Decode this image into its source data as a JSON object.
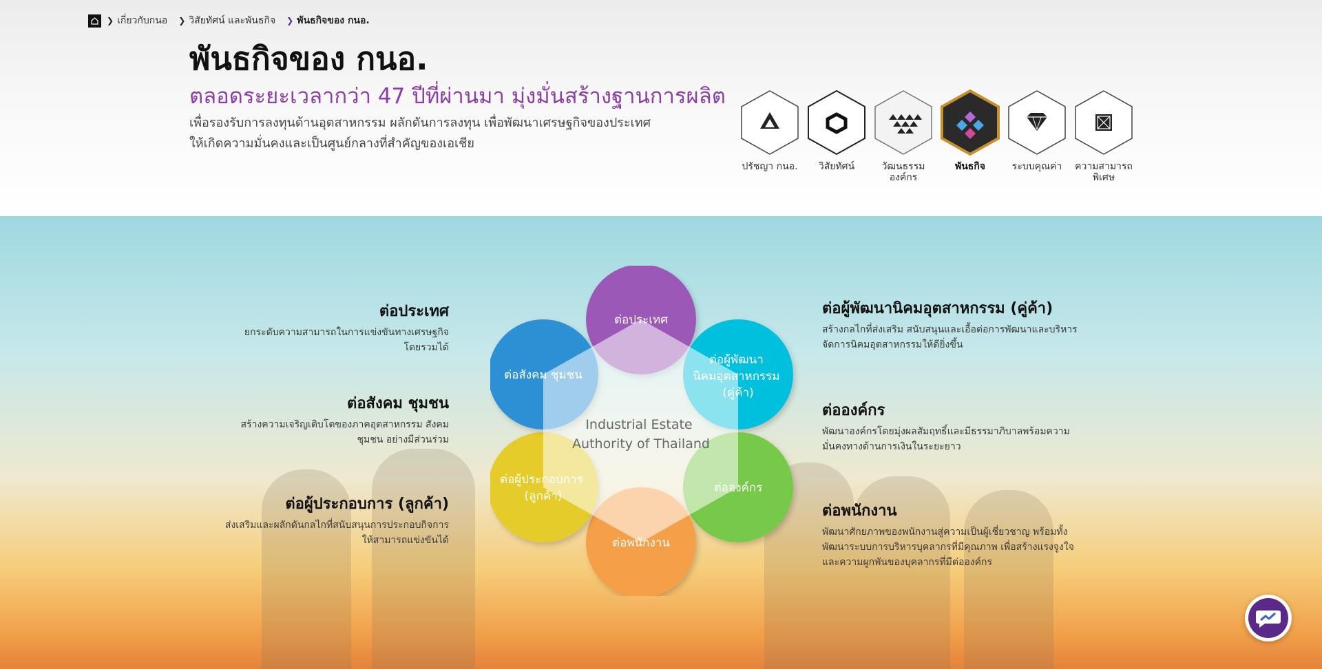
{
  "breadcrumb": {
    "items": [
      {
        "label": "เกี่ยวกับกนอ"
      },
      {
        "label": "วิสัยทัศน์ และพันธกิจ"
      },
      {
        "label": "พันธกิจของ กนอ."
      }
    ]
  },
  "header": {
    "title": "พันธกิจของ กนอ.",
    "subtitle": "ตลอดระยะเวลากว่า 47 ปีที่ผ่านมา มุ่งมั่นสร้างฐานการผลิต",
    "desc_line1": "เพื่อรองรับการลงทุนด้านอุตสาหกรรม ผลักดันการลงทุน เพื่อพัฒนาเศรษฐกิจของประเทศ",
    "desc_line2": "ให้เกิดความมั่นคงและเป็นศูนย์กลางที่สำคัญของเอเชีย"
  },
  "hex_menu": [
    {
      "label": "ปรัชญา กนอ.",
      "icon": "triangle-icon",
      "active": false
    },
    {
      "label": "วิสัยทัศน์",
      "icon": "hexagon-icon",
      "active": false
    },
    {
      "label": "วัฒนธรรมองค์กร",
      "icon": "triangles-icon",
      "active": false
    },
    {
      "label": "พันธกิจ",
      "icon": "diamond-cluster-icon",
      "active": true
    },
    {
      "label": "ระบบคุณค่า",
      "icon": "gem-icon",
      "active": false
    },
    {
      "label": "ความสามารถพิเศษ",
      "icon": "crossed-box-icon",
      "active": false
    }
  ],
  "diagram": {
    "center_line1": "Industrial Estate",
    "center_line2": "Authority of Thailand",
    "circles": {
      "top": "ต่อประเทศ",
      "top_right": [
        "ต่อผู้พัฒนา",
        "นิคมอุตสาหกรรม",
        "(คู่ค้า)"
      ],
      "bottom_right": "ต่อองค์กร",
      "bottom": "ต่อพนักงาน",
      "bottom_left": [
        "ต่อผู้ประกอบการ",
        "(ลูกค้า)"
      ],
      "top_left": "ต่อสังคม ชุมชน"
    },
    "colors": {
      "top": "#9b59b6",
      "top_right": "#00c0dd",
      "bottom_right": "#77c94a",
      "bottom": "#f5a04a",
      "bottom_left": "#e6cc2a",
      "top_left": "#2f90d4"
    }
  },
  "left_items": [
    {
      "title": "ต่อประเทศ",
      "line1": "ยกระดับความสามารถในการแข่งขันทางเศรษฐกิจ",
      "line2": "โดยรวมได้"
    },
    {
      "title": "ต่อสังคม ชุมชน",
      "line1": "สร้างความเจริญเติบโตของภาคอุตสาหกรรม สังคม",
      "line2": "ชุมชน อย่างมีส่วนร่วม"
    },
    {
      "title": "ต่อผู้ประกอบการ (ลูกค้า)",
      "line1": "ส่งเสริมและผลักดันกลไกที่สนับสนุนการประกอบกิจการ",
      "line2": "ให้สามารถแข่งขันได้"
    }
  ],
  "right_items": [
    {
      "title": "ต่อผู้พัฒนานิคมอุตสาหกรรม (คู่ค้า)",
      "line1": "สร้างกลไกที่ส่งเสริม สนับสนุนและเอื้อต่อการพัฒนาและบริหาร",
      "line2": "จัดการนิคมอุตสาหกรรมให้ดียิ่งขึ้น",
      "line3": ""
    },
    {
      "title": "ต่อองค์กร",
      "line1": "พัฒนาองค์กรโดยมุ่งผลสัมฤทธิ์และมีธรรมาภิบาลพร้อมความ",
      "line2": "มั่นคงทางด้านการเงินในระยะยาว",
      "line3": ""
    },
    {
      "title": "ต่อพนักงาน",
      "line1": "พัฒนาศักยภาพของพนักงานสู่ความเป็นผู้เชี่ยวชาญ พร้อมทั้ง",
      "line2": "พัฒนาระบบการบริหารบุคลากรที่มีคุณภาพ เพื่อสร้างแรงจูงใจ",
      "line3": "และความผูกพันของบุคลากรที่มีต่อองค์กร"
    }
  ],
  "chat": {
    "icon": "chat-trend-icon"
  }
}
